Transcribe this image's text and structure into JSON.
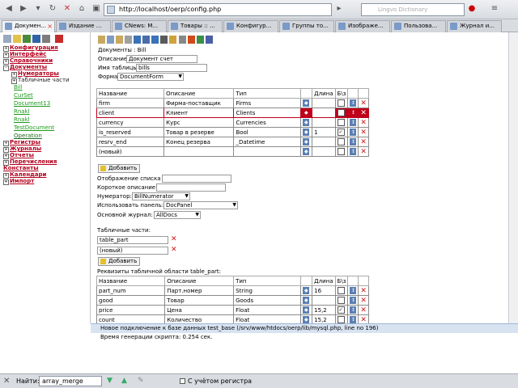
{
  "browser": {
    "url": "http://localhost/oerp/config.php",
    "search_placeholder": "Lingvo Dictionary",
    "tabs": [
      {
        "label": "Докумен...",
        "active": true
      },
      {
        "label": "Издание ...",
        "active": false
      },
      {
        "label": "CNews: M...",
        "active": false
      },
      {
        "label": "Товары :: ...",
        "active": false
      },
      {
        "label": "Конфигур...",
        "active": false
      },
      {
        "label": "Группы то...",
        "active": false
      },
      {
        "label": "Изображе...",
        "active": false
      },
      {
        "label": "Пользова...",
        "active": false
      },
      {
        "label": "Журнал и...",
        "active": false
      }
    ]
  },
  "sidebar": {
    "items": [
      {
        "label": "Конфигурация",
        "type": "main"
      },
      {
        "label": "Интерфейс",
        "type": "main"
      },
      {
        "label": "Справочники",
        "type": "main"
      },
      {
        "label": "Документы",
        "type": "main"
      },
      {
        "label": "Нумераторы",
        "type": "sub"
      },
      {
        "label": "Табличные части",
        "type": "subplain"
      },
      {
        "label": "Bill",
        "type": "leaf"
      },
      {
        "label": "CurSet",
        "type": "leaf"
      },
      {
        "label": "Document13",
        "type": "leaf"
      },
      {
        "label": "Rnakl",
        "type": "leaf"
      },
      {
        "label": "Rnakl",
        "type": "leaf"
      },
      {
        "label": "TestDocument",
        "type": "leaf"
      },
      {
        "label": "Operation",
        "type": "leafdark"
      },
      {
        "label": "Регистры",
        "type": "main"
      },
      {
        "label": "Журналы",
        "type": "main"
      },
      {
        "label": "Отчеты",
        "type": "main"
      },
      {
        "label": "Перечисления",
        "type": "main"
      },
      {
        "label": "Константы",
        "type": "main"
      },
      {
        "label": "Календари",
        "type": "main"
      },
      {
        "label": "Импорт",
        "type": "main"
      }
    ]
  },
  "form": {
    "doc_label": "Документы : Bill",
    "desc_label": "Описание",
    "desc_value": "Документ счет",
    "table_label": "Имя таблицы",
    "table_value": "bills",
    "form_label": "Форма",
    "form_value": "DocumentForm",
    "headers": [
      "Название",
      "Описание",
      "Тип",
      "Длина",
      "Б\\з"
    ],
    "rows": [
      {
        "name": "firm",
        "desc": "Фирма-поставщик",
        "type": "Firms",
        "len": "",
        "check": false,
        "error": false
      },
      {
        "name": "client",
        "desc": "Клиент",
        "type": "Clients",
        "len": "",
        "check": false,
        "error": true
      },
      {
        "name": "currency",
        "desc": "Курс",
        "type": "Currencies",
        "len": "",
        "check": false,
        "error": false
      },
      {
        "name": "is_reserved",
        "desc": "Товар в резерве",
        "type": "Bool",
        "len": "1",
        "check": true,
        "error": false
      },
      {
        "name": "resrv_end",
        "desc": "Конец резерва",
        "type": "_Datetime",
        "len": "",
        "check": false,
        "error": false
      },
      {
        "name": "(новый)",
        "desc": "",
        "type": "",
        "len": "",
        "check": false,
        "error": false
      }
    ],
    "add_label": "Добавить",
    "list_label": "Отображение списка",
    "short_label": "Короткое описание",
    "numerator_label": "Нумератор:",
    "numerator_value": "BillNumerator",
    "panel_label": "Использовать панель:",
    "panel_value": "DocPanel",
    "journal_label": "Основной журнал:",
    "journal_value": "AllDocs",
    "tparts_label": "Табличные части:",
    "tparts": [
      "table_part",
      "(новый)"
    ],
    "tparts_add_label": "Добавить",
    "req_label": "Реквизиты табличной области table_part:",
    "req_rows": [
      {
        "name": "part_num",
        "desc": "Парт.номер",
        "type": "String",
        "len": "16",
        "check": false
      },
      {
        "name": "good",
        "desc": "Товар",
        "type": "Goods",
        "len": "",
        "check": false
      },
      {
        "name": "price",
        "desc": "Цена",
        "type": "Float",
        "len": "15,2",
        "check": true
      },
      {
        "name": "count",
        "desc": "Количество",
        "type": "Float",
        "len": "15,2",
        "check": false
      }
    ]
  },
  "status": {
    "line1": "Новое подключение к базе данных test_base  (/srv/www/htdocs/oerp/lib/mysql.php, line no 196)",
    "line2": "Время генерации скрипта: 0.254 сек."
  },
  "findbar": {
    "label": "Найти:",
    "value": "array_merge",
    "case_label": "С учётом регистра"
  },
  "colors": {
    "accent": "#b4001e",
    "leaf": "#1c9a1c",
    "error": "#c0001a"
  }
}
